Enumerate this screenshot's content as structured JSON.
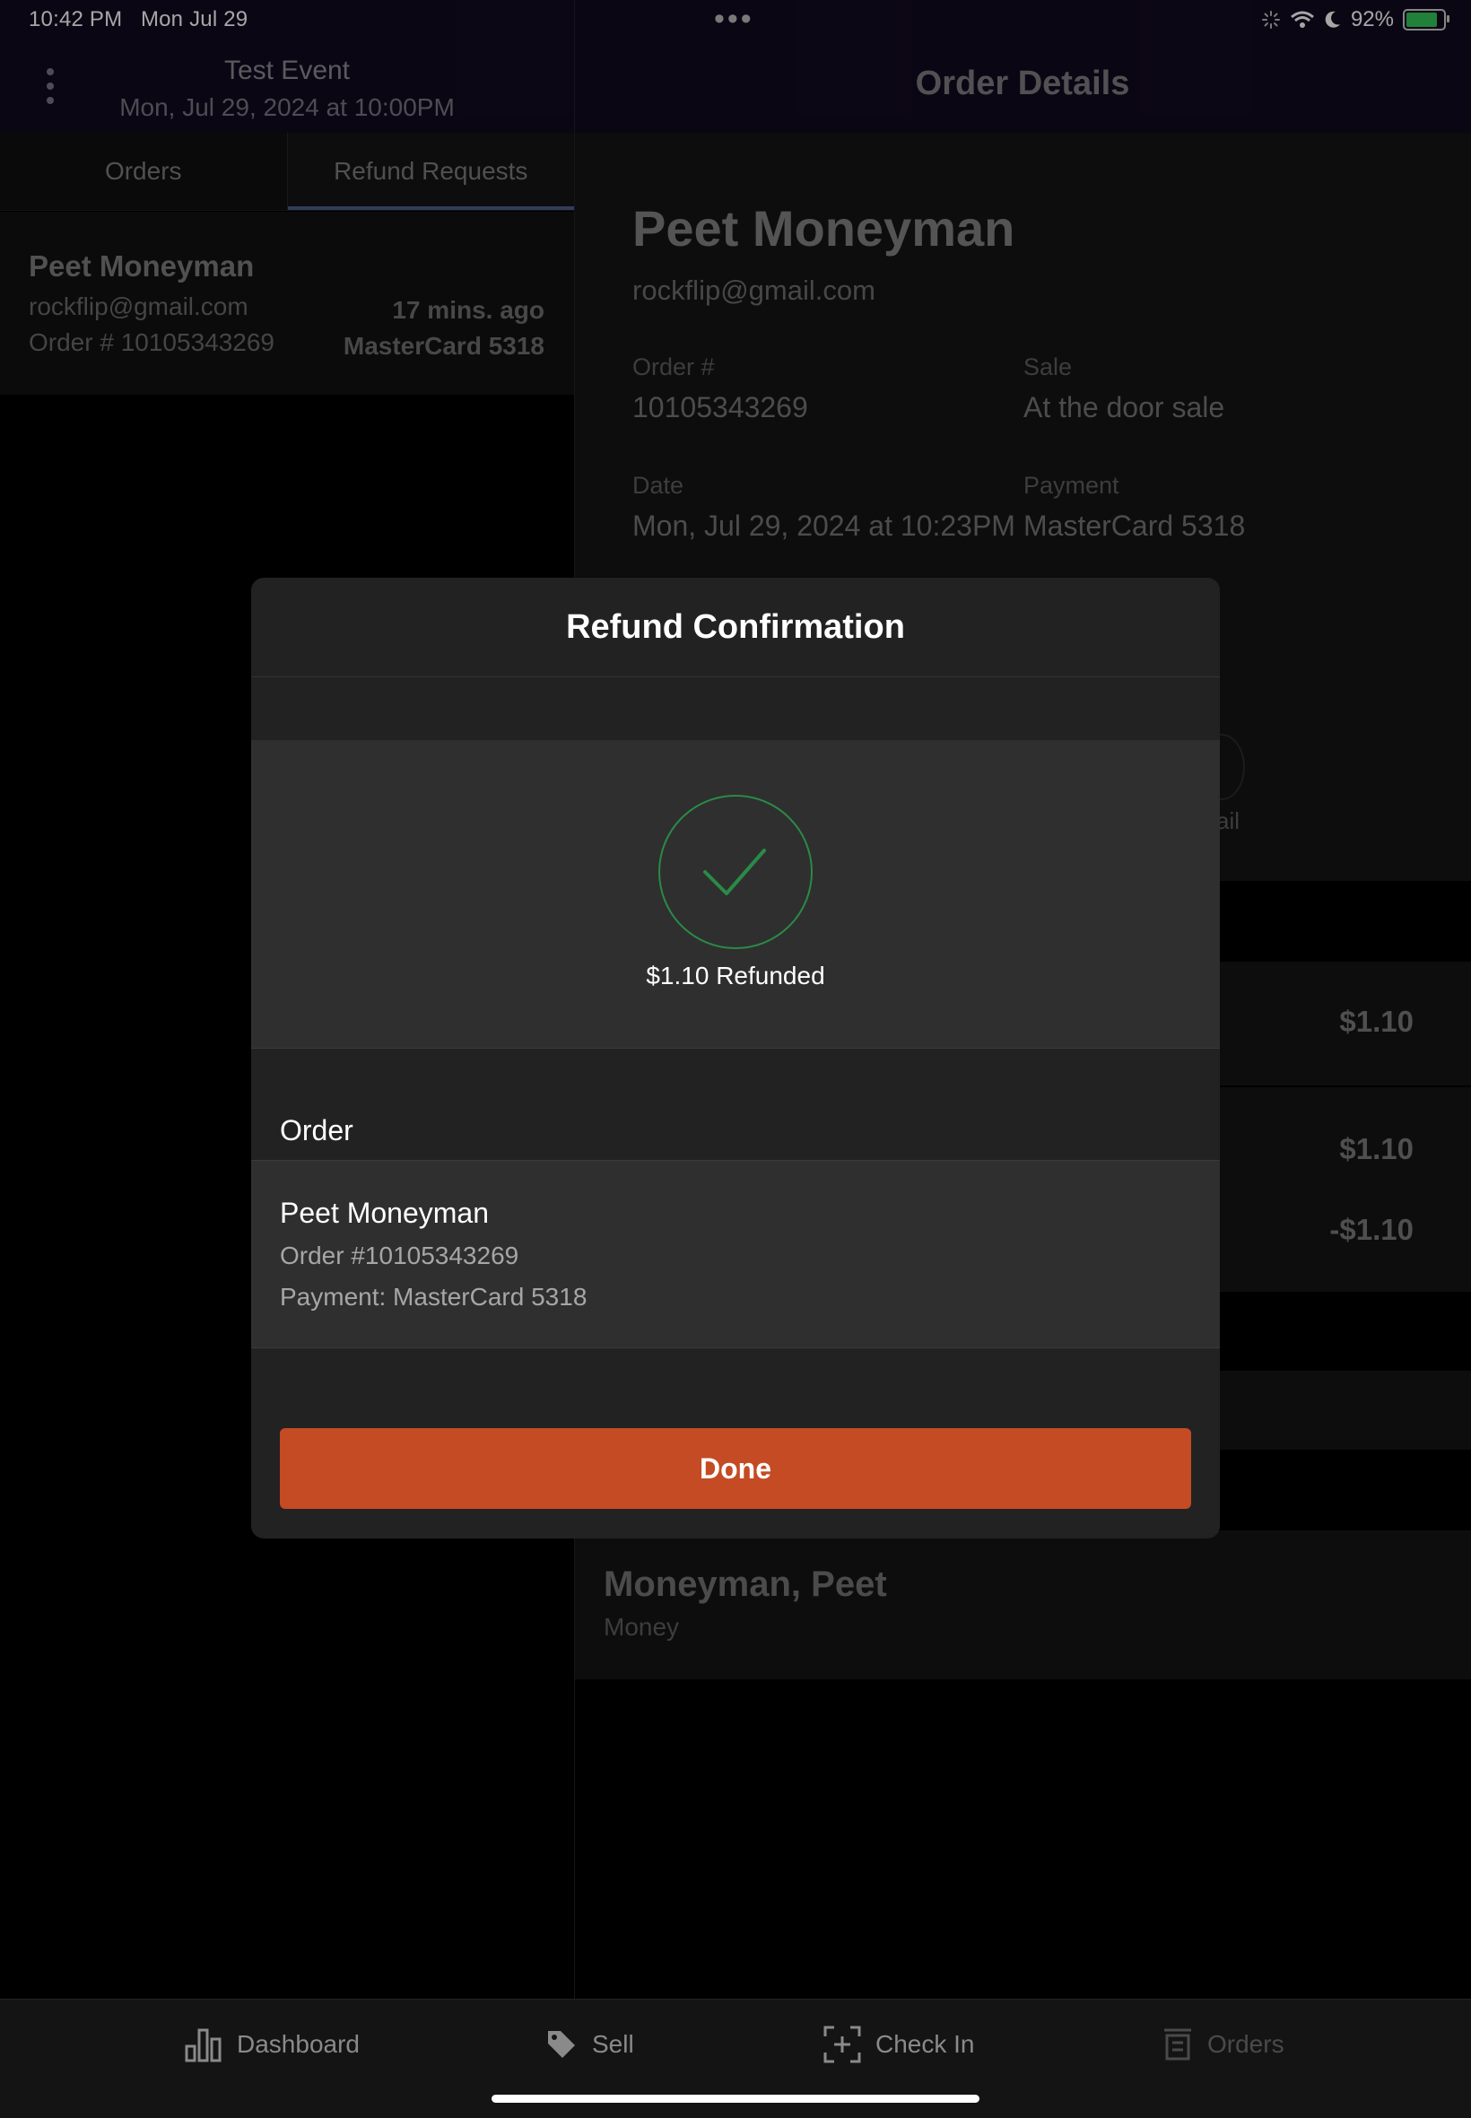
{
  "status_bar": {
    "time": "10:42 PM",
    "date": "Mon Jul 29",
    "dots": "•••",
    "battery": "92%"
  },
  "header": {
    "event_title": "Test Event",
    "event_date": "Mon, Jul 29, 2024 at 10:00PM",
    "details_title": "Order Details"
  },
  "left_tabs": [
    {
      "label": "Orders",
      "active": false
    },
    {
      "label": "Refund Requests",
      "active": true
    }
  ],
  "refund_request": {
    "name": "Peet Moneyman",
    "email": "rockflip@gmail.com",
    "order": "Order # 10105343269",
    "time_ago": "17 mins. ago",
    "payment": "MasterCard 5318"
  },
  "order_details": {
    "name": "Peet Moneyman",
    "email": "rockflip@gmail.com",
    "order_label": "Order #",
    "order_value": "10105343269",
    "sale_label": "Sale",
    "sale_value": "At the door sale",
    "date_label": "Date",
    "date_value": "Mon, Jul 29, 2024 at 10:23PM",
    "payment_label": "Payment",
    "payment_value": "MasterCard 5318",
    "email_action_partial": "ail",
    "amount_1": "$1.10",
    "amount_2": "$1.10",
    "amount_3": "-$1.10",
    "attendee_name": "Moneyman, Peet",
    "attendee_ticket": "Money"
  },
  "modal": {
    "title": "Refund Confirmation",
    "refunded_text": "$1.10 Refunded",
    "order_section_label": "Order",
    "order_name": "Peet Moneyman",
    "order_number": "Order #10105343269",
    "order_payment": "Payment: MasterCard 5318",
    "done_label": "Done",
    "success_color": "#2a8a47",
    "button_color": "#c44b24"
  },
  "tabbar": [
    {
      "label": "Dashboard",
      "icon": "bar-chart-icon",
      "active": true
    },
    {
      "label": "Sell",
      "icon": "tag-icon",
      "active": true
    },
    {
      "label": "Check In",
      "icon": "scan-plus-icon",
      "active": true
    },
    {
      "label": "Orders",
      "icon": "orders-icon",
      "active": false
    }
  ]
}
